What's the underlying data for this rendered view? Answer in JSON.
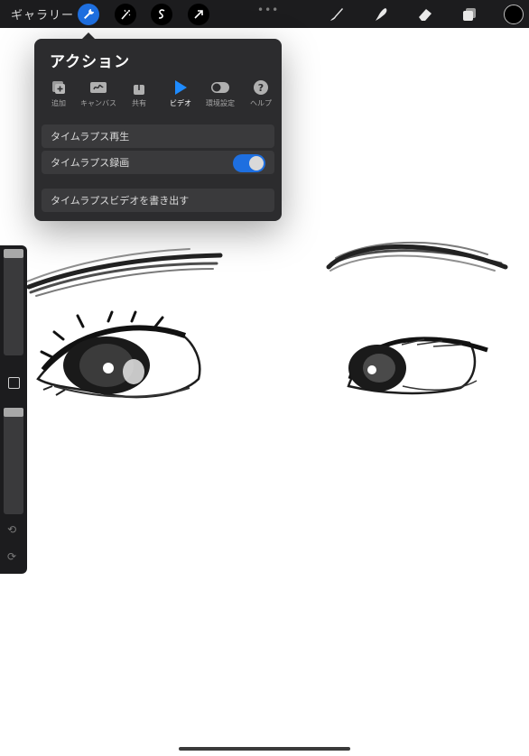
{
  "topbar": {
    "gallery_label": "ギャラリー",
    "more_dots": "•••",
    "active_color": "#1e6fe0",
    "selected_color": "#000000",
    "tools_left": [
      "wrench-icon",
      "adjustments-wand-icon",
      "selection-s-icon",
      "transform-arrow-icon"
    ],
    "tools_right": [
      "brush-icon",
      "smudge-icon",
      "eraser-icon",
      "layers-icon"
    ]
  },
  "actions": {
    "title": "アクション",
    "tabs": [
      {
        "label": "追加",
        "icon": "add-icon"
      },
      {
        "label": "キャンバス",
        "icon": "canvas-icon"
      },
      {
        "label": "共有",
        "icon": "share-icon"
      },
      {
        "label": "ビデオ",
        "icon": "video-play-icon",
        "active": true
      },
      {
        "label": "環境設定",
        "icon": "preferences-toggle-icon"
      },
      {
        "label": "ヘルプ",
        "icon": "help-icon"
      }
    ],
    "rows": {
      "replay": "タイムラプス再生",
      "record": "タイムラプス録画",
      "record_enabled": true,
      "export": "タイムラプスビデオを書き出す"
    }
  },
  "sidebar": {
    "brush_size_level": 0.0,
    "brush_opacity_level": 0.0,
    "undo_glyph": "⟲",
    "redo_glyph": "⟳"
  }
}
